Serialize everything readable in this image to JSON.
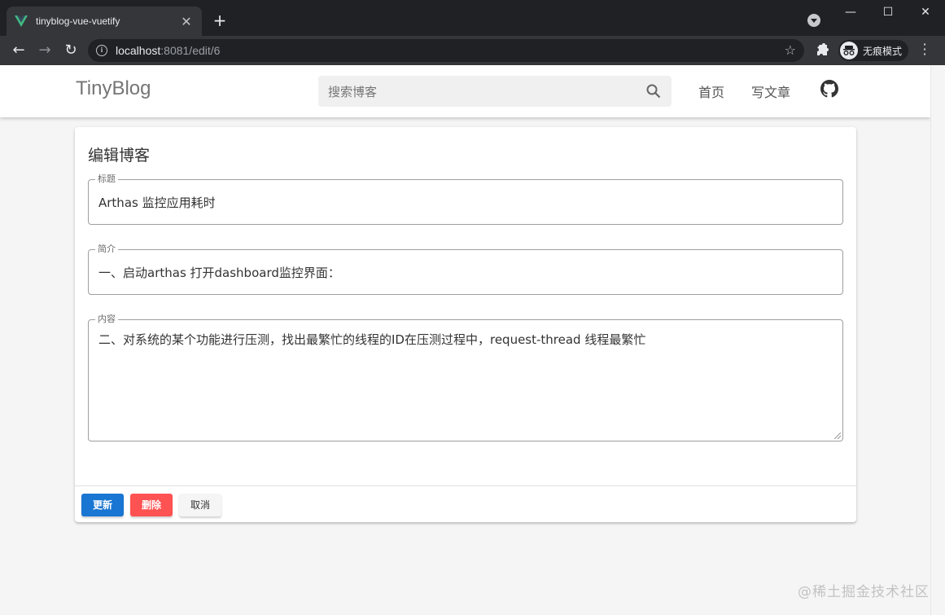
{
  "browser": {
    "tab_title": "tinyblog-vue-vuetify",
    "tab_close": "✕",
    "new_tab": "+",
    "url_host": "localhost",
    "url_path": ":8081/edit/6",
    "incognito_label": "无痕模式",
    "window_controls": {
      "minimize": "—",
      "maximize": "☐",
      "close": "✕"
    }
  },
  "appbar": {
    "brand": "TinyBlog",
    "search_placeholder": "搜索博客",
    "nav": {
      "home": "首页",
      "write": "写文章"
    }
  },
  "editor": {
    "title": "编辑博客",
    "fields": {
      "title": {
        "label": "标题",
        "value": "Arthas 监控应用耗时"
      },
      "summary": {
        "label": "简介",
        "value": "一、启动arthas 打开dashboard监控界面："
      },
      "content": {
        "label": "内容",
        "value": "二、对系统的某个功能进行压测，找出最繁忙的线程的ID在压测过程中，request-thread 线程最繁忙"
      }
    },
    "buttons": {
      "update": "更新",
      "delete": "删除",
      "cancel": "取消"
    }
  },
  "colors": {
    "primary": "#1976d2",
    "danger": "#ff5252",
    "vue_green": "#41b883"
  },
  "watermark": "@稀土掘金技术社区"
}
